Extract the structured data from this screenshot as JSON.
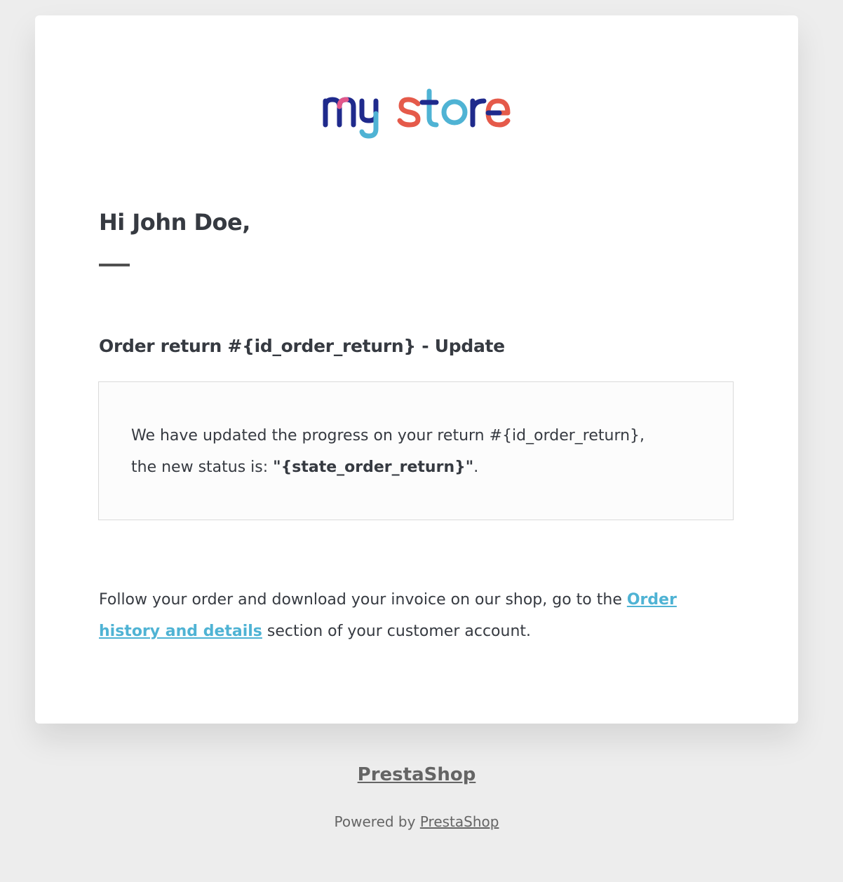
{
  "email": {
    "logo_alt": "my store",
    "greeting": "Hi John Doe,",
    "section_title": "Order return #{id_order_return} - Update",
    "message": {
      "line1": "We have updated the progress on your return #{id_order_return},",
      "line2_prefix": "the new status is: ",
      "status_value": "\"{state_order_return}\"",
      "line2_suffix": "."
    },
    "follow": {
      "prefix": "Follow your order and download your invoice on our shop, go to the ",
      "link_text": "Order history and details",
      "suffix": " section of your customer account."
    }
  },
  "footer": {
    "shop_name": "PrestaShop",
    "powered_prefix": "Powered by ",
    "powered_link": "PrestaShop"
  },
  "colors": {
    "background": "#ededed",
    "card": "#ffffff",
    "text": "#363a41",
    "link": "#4fb3d4",
    "footer_text": "#656565",
    "logo_navy": "#1f2a8c",
    "logo_pink": "#e2578a",
    "logo_cyan": "#4fb3d4",
    "logo_red": "#e55a4a"
  }
}
